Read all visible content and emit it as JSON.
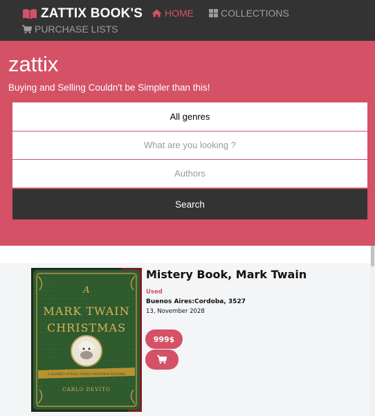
{
  "navbar": {
    "brand": "ZATTIX BOOK'S",
    "links": [
      {
        "label": "HOME",
        "icon": "home-icon",
        "active": true
      },
      {
        "label": "COLLECTIONS",
        "icon": "grid-icon",
        "active": false
      },
      {
        "label": "PURCHASE LISTS",
        "icon": "cart-icon",
        "active": false
      }
    ]
  },
  "hero": {
    "title": "zattix",
    "subtitle": "Buying and Selling Couldn't be Simpler than this!",
    "genre_select": "All genres",
    "search_placeholder": "What are you looking ?",
    "authors_placeholder": "Authors",
    "search_button": "Search"
  },
  "listing": {
    "title": "Mistery Book, Mark Twain",
    "condition": "Used",
    "location": "Buenos Aires:Cordoba, 3527",
    "date": "13, November 2028",
    "price": "999$",
    "cover": {
      "line1": "A",
      "line2": "MARK TWAIN",
      "line3": "CHRISTMAS",
      "tagline": "A JOURNEY ACROSS THREE CHRISTMAS SEASONS",
      "author": "CARLO DEVITO"
    }
  },
  "colors": {
    "accent": "#d45166",
    "nav_bg": "#333333",
    "cover_green": "#2f5a2e"
  }
}
